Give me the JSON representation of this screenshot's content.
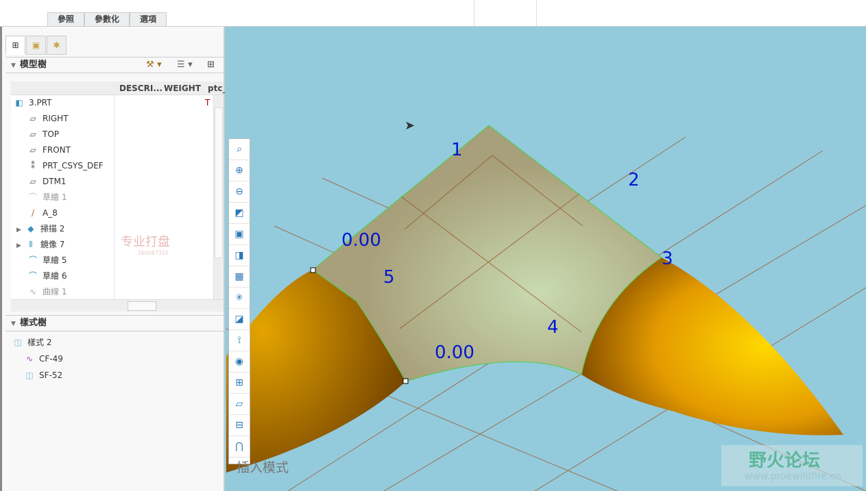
{
  "ribbon_tabs": [
    "參照",
    "參數化",
    "選項"
  ],
  "model_tree": {
    "title": "模型樹",
    "columns": [
      "DESCRI...",
      "WEIGHT",
      "ptc_"
    ],
    "items": [
      {
        "label": "3.PRT",
        "icon": "part-icon",
        "t": "T"
      },
      {
        "label": "RIGHT",
        "icon": "datum-plane-icon"
      },
      {
        "label": "TOP",
        "icon": "datum-plane-icon"
      },
      {
        "label": "FRONT",
        "icon": "datum-plane-icon"
      },
      {
        "label": "PRT_CSYS_DEF",
        "icon": "csys-icon"
      },
      {
        "label": "DTM1",
        "icon": "datum-plane-icon"
      },
      {
        "label": "草繪 1",
        "icon": "sketch-icon",
        "dim": true
      },
      {
        "label": "A_8",
        "icon": "axis-icon"
      },
      {
        "label": "掃描 2",
        "icon": "sweep-icon",
        "expand": true
      },
      {
        "label": "鏡像 7",
        "icon": "mirror-icon",
        "expand": true
      },
      {
        "label": "草繪 5",
        "icon": "sketch-icon"
      },
      {
        "label": "草繪 6",
        "icon": "sketch-icon"
      },
      {
        "label": "曲線 1",
        "icon": "curve-icon",
        "dim": true
      }
    ]
  },
  "style_tree": {
    "title": "樣式樹",
    "items": [
      {
        "label": "樣式 2"
      },
      {
        "label": "CF-49"
      },
      {
        "label": "SF-52"
      }
    ]
  },
  "viewport": {
    "labels": [
      "1",
      "2",
      "3",
      "4",
      "5"
    ],
    "dims": [
      "0.00",
      "0.00"
    ],
    "mode_text": "插入模式"
  },
  "watermarks": {
    "shop": "专业打盘",
    "shop_id": "340047351",
    "forum": "野火论坛",
    "forum_url": "www.proewildfire.cn"
  }
}
